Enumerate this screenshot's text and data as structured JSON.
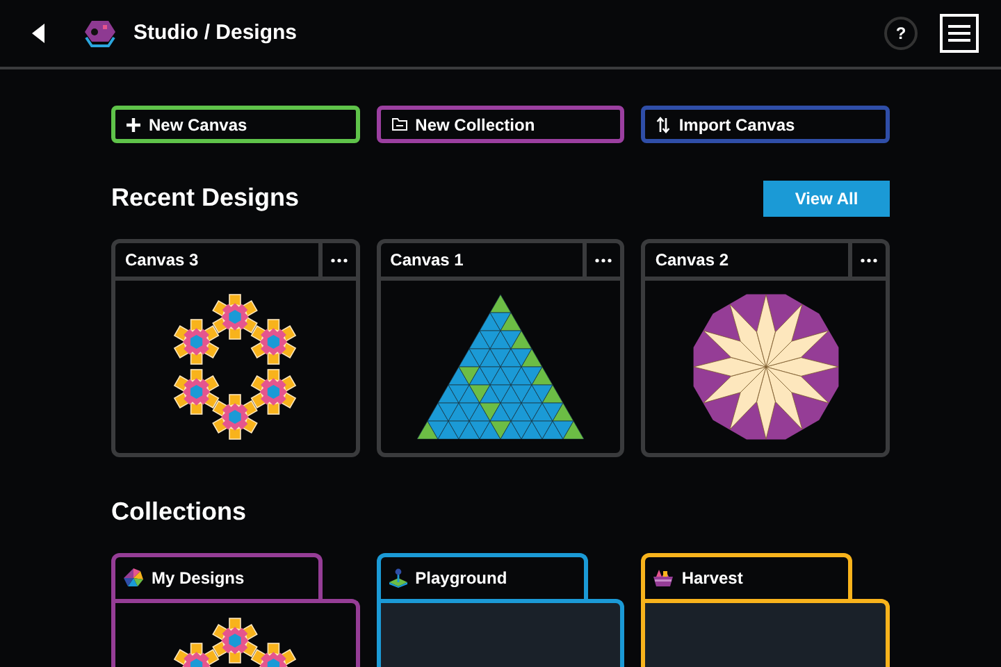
{
  "header": {
    "title": "Studio / Designs",
    "help": "?"
  },
  "actions": [
    {
      "label": "New Canvas",
      "kind": "plus",
      "color": "#5fc34a"
    },
    {
      "label": "New Collection",
      "kind": "folder",
      "color": "#9b3fa0"
    },
    {
      "label": "Import Canvas",
      "kind": "import",
      "color": "#2f4ea8"
    }
  ],
  "recent": {
    "title": "Recent Designs",
    "view_all": "View All",
    "designs": [
      {
        "name": "Canvas 3",
        "kind": "flower-ring"
      },
      {
        "name": "Canvas 1",
        "kind": "triangle-tiling"
      },
      {
        "name": "Canvas 2",
        "kind": "star-dodecagon"
      }
    ]
  },
  "collections": {
    "title": "Collections",
    "items": [
      {
        "name": "My Designs",
        "color": "#953d96",
        "kind": "pinwheel",
        "preview": true
      },
      {
        "name": "Playground",
        "color": "#1b9ad6",
        "kind": "joystick",
        "preview": false
      },
      {
        "name": "Harvest",
        "color": "#f8b31c",
        "kind": "basket",
        "preview": false
      }
    ]
  }
}
